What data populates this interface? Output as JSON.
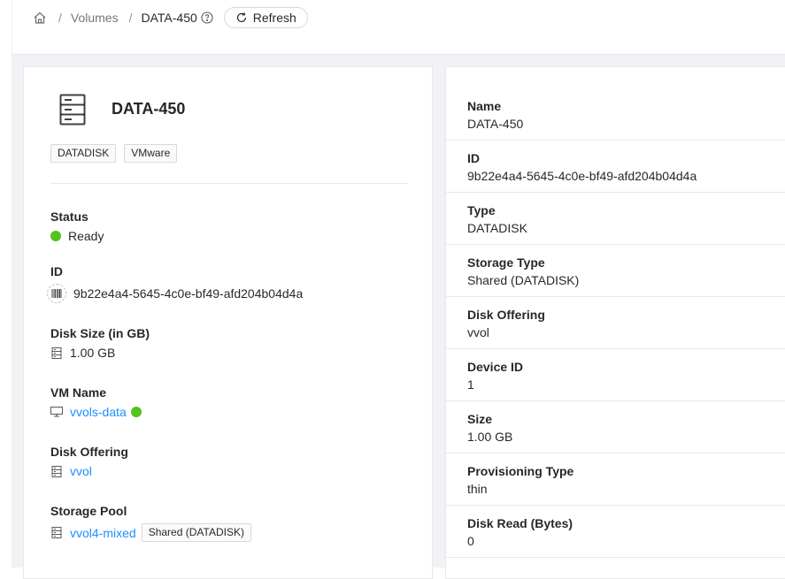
{
  "breadcrumb": {
    "home_icon": "home-icon",
    "sep": "/",
    "volumes": "Volumes",
    "current": "DATA-450",
    "help_icon": "question-circle-icon",
    "refresh_label": "Refresh",
    "refresh_icon": "reload-icon"
  },
  "summary": {
    "title": "DATA-450",
    "icon": "storage-server-icon",
    "tags": [
      "DATADISK",
      "VMware"
    ],
    "status": {
      "label": "Status",
      "value": "Ready",
      "color": "#52c41a"
    },
    "id": {
      "label": "ID",
      "value": "9b22e4a4-5645-4c0e-bf49-afd204b04d4a",
      "icon": "barcode-icon"
    },
    "disk_size": {
      "label": "Disk Size (in GB)",
      "value": "1.00 GB",
      "icon": "database-icon"
    },
    "vm_name": {
      "label": "VM Name",
      "value": "vvols-data",
      "icon": "desktop-icon"
    },
    "disk_offering": {
      "label": "Disk Offering",
      "value": "vvol",
      "icon": "database-icon"
    },
    "storage_pool": {
      "label": "Storage Pool",
      "value": "vvol4-mixed",
      "tag": "Shared (DATADISK)",
      "icon": "database-icon"
    }
  },
  "details": [
    {
      "label": "Name",
      "value": "DATA-450"
    },
    {
      "label": "ID",
      "value": "9b22e4a4-5645-4c0e-bf49-afd204b04d4a"
    },
    {
      "label": "Type",
      "value": "DATADISK"
    },
    {
      "label": "Storage Type",
      "value": "Shared (DATADISK)"
    },
    {
      "label": "Disk Offering",
      "value": "vvol"
    },
    {
      "label": "Device ID",
      "value": "1"
    },
    {
      "label": "Size",
      "value": "1.00 GB"
    },
    {
      "label": "Provisioning Type",
      "value": "thin"
    },
    {
      "label": "Disk Read (Bytes)",
      "value": "0"
    }
  ],
  "colors": {
    "link": "#1890ff",
    "status_ready": "#52c41a"
  }
}
